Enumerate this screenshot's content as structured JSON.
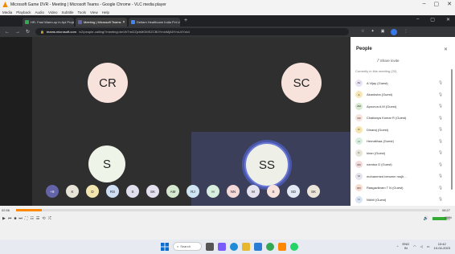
{
  "vlc": {
    "title": "Microsoft Game DVR - Meeting | Microsoft Teams - Google Chrome - VLC media player",
    "menu": [
      "Media",
      "Playback",
      "Audio",
      "Video",
      "Subtitle",
      "Tools",
      "View",
      "Help"
    ],
    "time_current": "02:56",
    "time_total": "08:27",
    "progress_fraction": 0.06,
    "volume_percent": "100%"
  },
  "chrome": {
    "tabs": [
      {
        "label": "HR- Fast Warm-up in Api Project",
        "color": "#34a853",
        "active": false
      },
      {
        "label": "Meeting | Microsoft Teams",
        "color": "#6264a7",
        "active": true
      },
      {
        "label": "Deltam Healthcare India Pvt Ltd.",
        "color": "#4285f4",
        "active": false
      }
    ],
    "new_tab": "+",
    "url_host": "teams.microsoft.com",
    "url_path": "/v2/people-calling/?meeting=bnVbTmI2ZjxhMGMSZCB0YmIxMjA5YmU4Yzk4"
  },
  "meeting": {
    "tiles": [
      {
        "initials": "CR",
        "color": "#f7e2dc"
      },
      {
        "initials": "SC",
        "color": "#f7e2dc"
      },
      {
        "initials": "S",
        "color": "#eef4e8"
      },
      {
        "initials": "SS",
        "color": "#eef0e8"
      }
    ],
    "strip": [
      {
        "initials": "+8",
        "color": "#6264a7"
      },
      {
        "initials": "K",
        "color": "#e8e4d8"
      },
      {
        "initials": "D",
        "color": "#f3e6b0"
      },
      {
        "initials": "RS",
        "color": "#cfe0f5"
      },
      {
        "initials": "S",
        "color": "#e0dfee"
      },
      {
        "initials": "SK",
        "color": "#e4e0f0"
      },
      {
        "initials": "AM",
        "color": "#d6e8d0"
      },
      {
        "initials": "RJ",
        "color": "#cfe5f3"
      },
      {
        "initials": "H",
        "color": "#d8eede"
      },
      {
        "initials": "NN",
        "color": "#f4d9d9"
      },
      {
        "initials": "M",
        "color": "#e6e2ee"
      },
      {
        "initials": "S",
        "color": "#f7e2dc"
      },
      {
        "initials": "SD",
        "color": "#e2e8f4"
      },
      {
        "initials": "SK",
        "color": "#ece6da"
      }
    ]
  },
  "people": {
    "title": "People",
    "share_invite": "Share invite",
    "section": "Currently in this meeting (22)",
    "list": [
      {
        "initials": "AV",
        "name": "A Vijay (Guest)",
        "color": "#e9e2f5"
      },
      {
        "initials": "A",
        "name": "Akanksha (Guest)",
        "color": "#f6e7b6"
      },
      {
        "initials": "AM",
        "name": "Apoorva A M (Guest)",
        "color": "#d6e8d0"
      },
      {
        "initials": "CR",
        "name": "Chaitanya Kumar R (Guest)",
        "color": "#f7e2dc"
      },
      {
        "initials": "D",
        "name": "Dinaraj (Guest)",
        "color": "#f3e6b0"
      },
      {
        "initials": "H",
        "name": "Hemalthaa (Guest)",
        "color": "#d8eede"
      },
      {
        "initials": "K",
        "name": "kiran (Guest)",
        "color": "#e8e4d8"
      },
      {
        "initials": "NN",
        "name": "namisa G (Guest)",
        "color": "#f4d9d9"
      },
      {
        "initials": "M",
        "name": "mohammed benzem mujh...",
        "color": "#e6e2ee"
      },
      {
        "initials": "RN",
        "name": "Raagavikram T N (Guest)",
        "color": "#f7dcd0"
      },
      {
        "initials": "N",
        "name": "Nikhil (Guest)",
        "color": "#d8e4f4"
      },
      {
        "initials": "PB",
        "name": "Prashant Bhaskkar (Guest)",
        "color": "#f3d8e6"
      }
    ]
  },
  "taskbar": {
    "search_label": "Search",
    "lang": "ENG",
    "region": "IN",
    "time": "10:42",
    "date": "10-04-2023"
  }
}
